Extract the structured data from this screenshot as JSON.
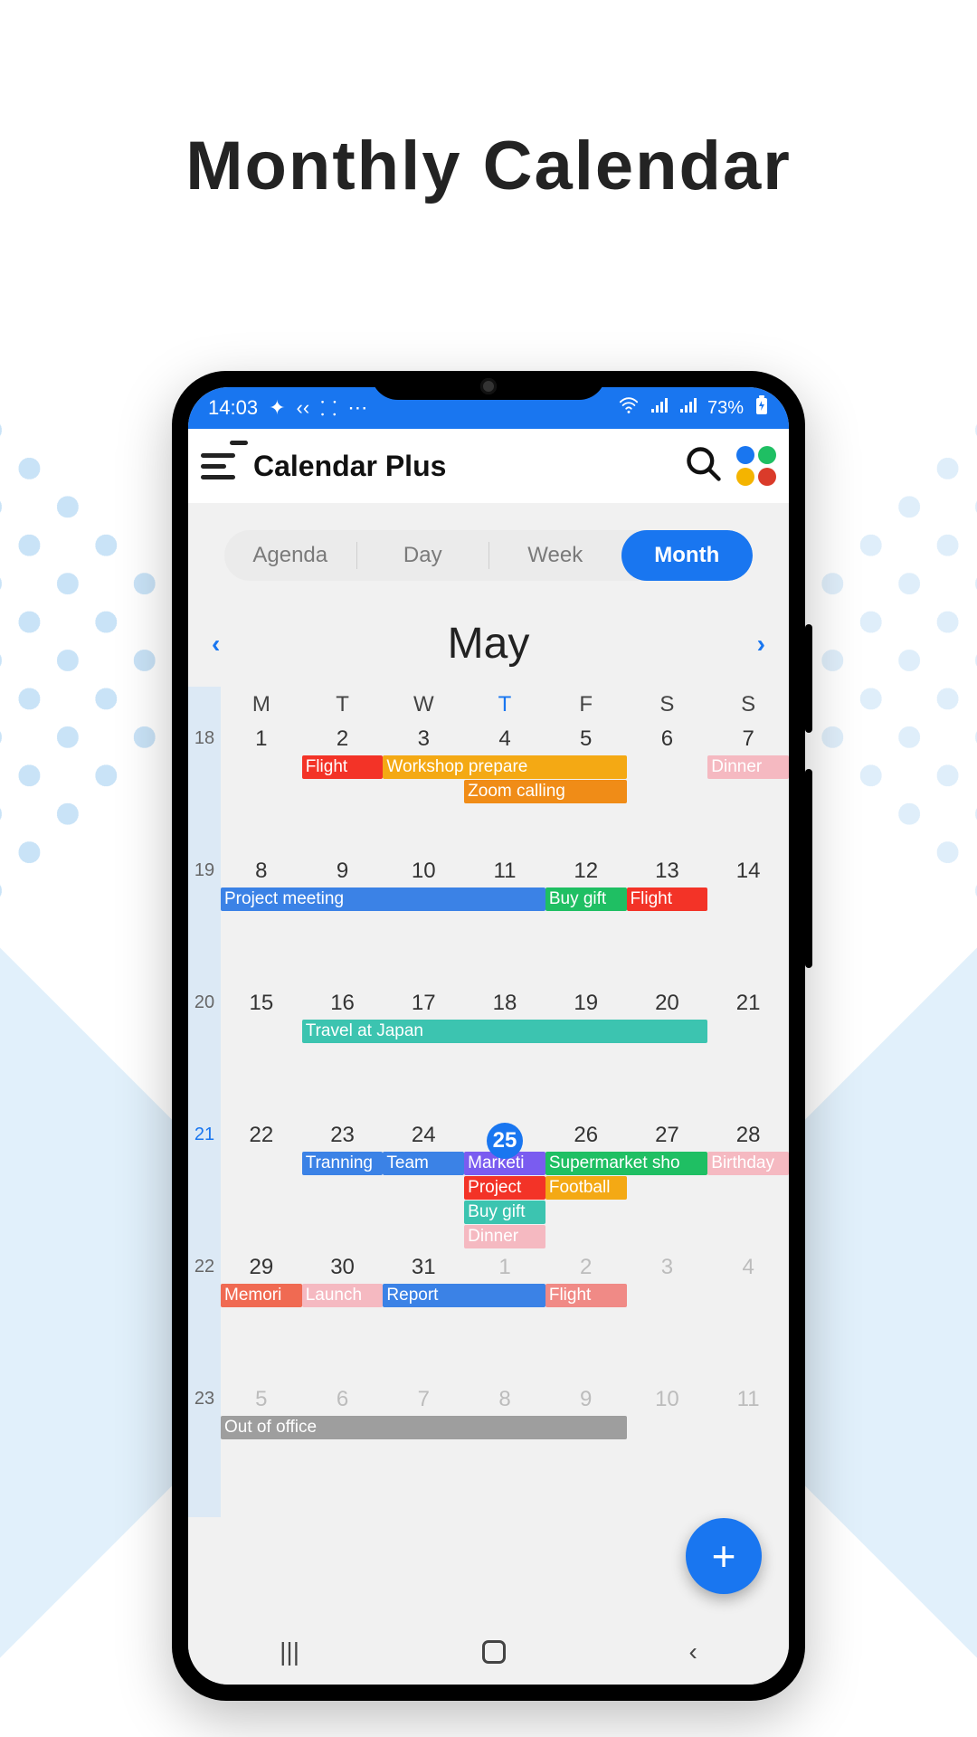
{
  "promo": {
    "title": "Monthly Calendar"
  },
  "status": {
    "time": "14:03",
    "battery": "73%"
  },
  "header": {
    "app_name": "Calendar Plus"
  },
  "view_switch": {
    "agenda": "Agenda",
    "day": "Day",
    "week": "Week",
    "month": "Month",
    "active": "month"
  },
  "month_nav": {
    "label": "May",
    "prev": "‹",
    "next": "›"
  },
  "dow": [
    "M",
    "T",
    "W",
    "T",
    "F",
    "S",
    "S"
  ],
  "weeks": [
    {
      "num": "18",
      "days": [
        {
          "n": "1"
        },
        {
          "n": "2"
        },
        {
          "n": "3"
        },
        {
          "n": "4"
        },
        {
          "n": "5"
        },
        {
          "n": "6"
        },
        {
          "n": "7"
        }
      ],
      "events": [
        {
          "label": "Flight",
          "row": 0,
          "colStart": 1,
          "colSpan": 1,
          "color": "#f33327"
        },
        {
          "label": "Workshop prepare",
          "row": 0,
          "colStart": 2,
          "colSpan": 3,
          "color": "#f4a914"
        },
        {
          "label": "Zoom calling",
          "row": 1,
          "colStart": 3,
          "colSpan": 2,
          "color": "#f08c17"
        },
        {
          "label": "Dinner",
          "row": 0,
          "colStart": 6,
          "colSpan": 1,
          "color": "#f5b9c1"
        }
      ]
    },
    {
      "num": "19",
      "days": [
        {
          "n": "8"
        },
        {
          "n": "9"
        },
        {
          "n": "10"
        },
        {
          "n": "11"
        },
        {
          "n": "12"
        },
        {
          "n": "13"
        },
        {
          "n": "14"
        }
      ],
      "events": [
        {
          "label": "Project meeting",
          "row": 0,
          "colStart": 0,
          "colSpan": 4,
          "color": "#3b82e6"
        },
        {
          "label": "Buy gift",
          "row": 0,
          "colStart": 4,
          "colSpan": 1,
          "color": "#1fbf63"
        },
        {
          "label": "Flight",
          "row": 0,
          "colStart": 5,
          "colSpan": 1,
          "color": "#f33327"
        }
      ]
    },
    {
      "num": "20",
      "days": [
        {
          "n": "15"
        },
        {
          "n": "16"
        },
        {
          "n": "17"
        },
        {
          "n": "18"
        },
        {
          "n": "19"
        },
        {
          "n": "20"
        },
        {
          "n": "21"
        }
      ],
      "events": [
        {
          "label": "Travel at Japan",
          "row": 0,
          "colStart": 1,
          "colSpan": 5,
          "color": "#3cc4b0"
        }
      ]
    },
    {
      "num": "21",
      "num_hl": true,
      "days": [
        {
          "n": "22"
        },
        {
          "n": "23"
        },
        {
          "n": "24"
        },
        {
          "n": "25",
          "today": true
        },
        {
          "n": "26"
        },
        {
          "n": "27"
        },
        {
          "n": "28"
        }
      ],
      "events": [
        {
          "label": "Tranning",
          "row": 0,
          "colStart": 1,
          "colSpan": 1,
          "color": "#3b82e6"
        },
        {
          "label": "Team",
          "row": 0,
          "colStart": 2,
          "colSpan": 1,
          "color": "#3b82e6"
        },
        {
          "label": "Marketi",
          "row": 0,
          "colStart": 3,
          "colSpan": 1,
          "color": "#7a5cf0"
        },
        {
          "label": "Supermarket sho",
          "row": 0,
          "colStart": 4,
          "colSpan": 2,
          "color": "#1fbf63"
        },
        {
          "label": "Birthday",
          "row": 0,
          "colStart": 6,
          "colSpan": 1,
          "color": "#f5b9c1"
        },
        {
          "label": "Project",
          "row": 1,
          "colStart": 3,
          "colSpan": 1,
          "color": "#f33327"
        },
        {
          "label": "Football",
          "row": 1,
          "colStart": 4,
          "colSpan": 1,
          "color": "#f4a914"
        },
        {
          "label": "Buy gift",
          "row": 2,
          "colStart": 3,
          "colSpan": 1,
          "color": "#3cc4b0"
        },
        {
          "label": "Dinner",
          "row": 3,
          "colStart": 3,
          "colSpan": 1,
          "color": "#f5b9c1"
        }
      ]
    },
    {
      "num": "22",
      "days": [
        {
          "n": "29"
        },
        {
          "n": "30"
        },
        {
          "n": "31"
        },
        {
          "n": "1",
          "dim": true
        },
        {
          "n": "2",
          "dim": true
        },
        {
          "n": "3",
          "dim": true
        },
        {
          "n": "4",
          "dim": true
        }
      ],
      "events": [
        {
          "label": "Memori",
          "row": 0,
          "colStart": 0,
          "colSpan": 1,
          "color": "#f06a52"
        },
        {
          "label": "Launch",
          "row": 0,
          "colStart": 1,
          "colSpan": 1,
          "color": "#f5b9c1"
        },
        {
          "label": "Report",
          "row": 0,
          "colStart": 2,
          "colSpan": 2,
          "color": "#3b82e6"
        },
        {
          "label": "Flight",
          "row": 0,
          "colStart": 4,
          "colSpan": 1,
          "color": "#f08a86"
        }
      ]
    },
    {
      "num": "23",
      "days": [
        {
          "n": "5",
          "dim": true
        },
        {
          "n": "6",
          "dim": true
        },
        {
          "n": "7",
          "dim": true
        },
        {
          "n": "8",
          "dim": true
        },
        {
          "n": "9",
          "dim": true
        },
        {
          "n": "10",
          "dim": true
        },
        {
          "n": "11",
          "dim": true
        }
      ],
      "events": [
        {
          "label": "Out of office",
          "row": 0,
          "colStart": 0,
          "colSpan": 5,
          "color": "#9e9e9e"
        }
      ]
    }
  ],
  "fab": {
    "glyph": "+"
  },
  "colors": {
    "apps": [
      "#1976f0",
      "#1fbf63",
      "#f4b400",
      "#da3b2a"
    ]
  }
}
